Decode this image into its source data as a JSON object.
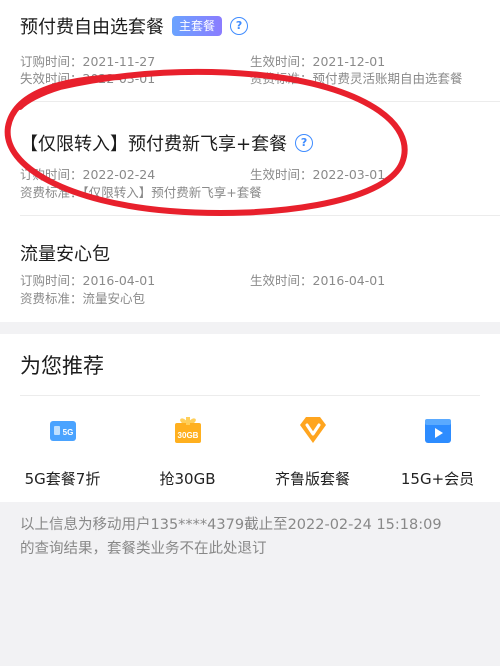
{
  "packages": [
    {
      "title": "预付费自由选套餐",
      "badge": "主套餐",
      "fields": [
        {
          "label": "订购时间：",
          "value": "2021-11-27"
        },
        {
          "label": "生效时间：",
          "value": "2021-12-01"
        },
        {
          "label": "失效时间：",
          "value": "2022-03-01"
        },
        {
          "label": "资费标准：",
          "value": "预付费灵活账期自由选套餐"
        }
      ]
    },
    {
      "title": "【仅限转入】预付费新飞享+套餐",
      "fields": [
        {
          "label": "订购时间：",
          "value": "2022-02-24"
        },
        {
          "label": "生效时间：",
          "value": "2022-03-01"
        },
        {
          "label": "资费标准：",
          "value": "【仅限转入】预付费新飞享+套餐"
        }
      ]
    },
    {
      "title": "流量安心包",
      "fields": [
        {
          "label": "订购时间：",
          "value": "2016-04-01"
        },
        {
          "label": "生效时间：",
          "value": "2016-04-01"
        },
        {
          "label": "资费标准：",
          "value": "流量安心包"
        }
      ]
    }
  ],
  "recommend": {
    "title": "为您推荐",
    "items": [
      {
        "label": "5G套餐7折",
        "icon": "sim-5g-icon",
        "icon_text": "5G"
      },
      {
        "label": "抢30GB",
        "icon": "gift-30gb-icon",
        "icon_text": "30GB"
      },
      {
        "label": "齐鲁版套餐",
        "icon": "diamond-v-icon"
      },
      {
        "label": "15G+会员",
        "icon": "video-play-icon"
      }
    ]
  },
  "footer": {
    "line1": "以上信息为移动用户135****4379截止至2022-02-24 15:18:09",
    "line2": "的查询结果，套餐类业务不在此处退订"
  },
  "colors": {
    "accent": "#3f8cff",
    "circle": "#e8202c",
    "badge_start": "#6aa3ff",
    "badge_end": "#8b7cff"
  }
}
